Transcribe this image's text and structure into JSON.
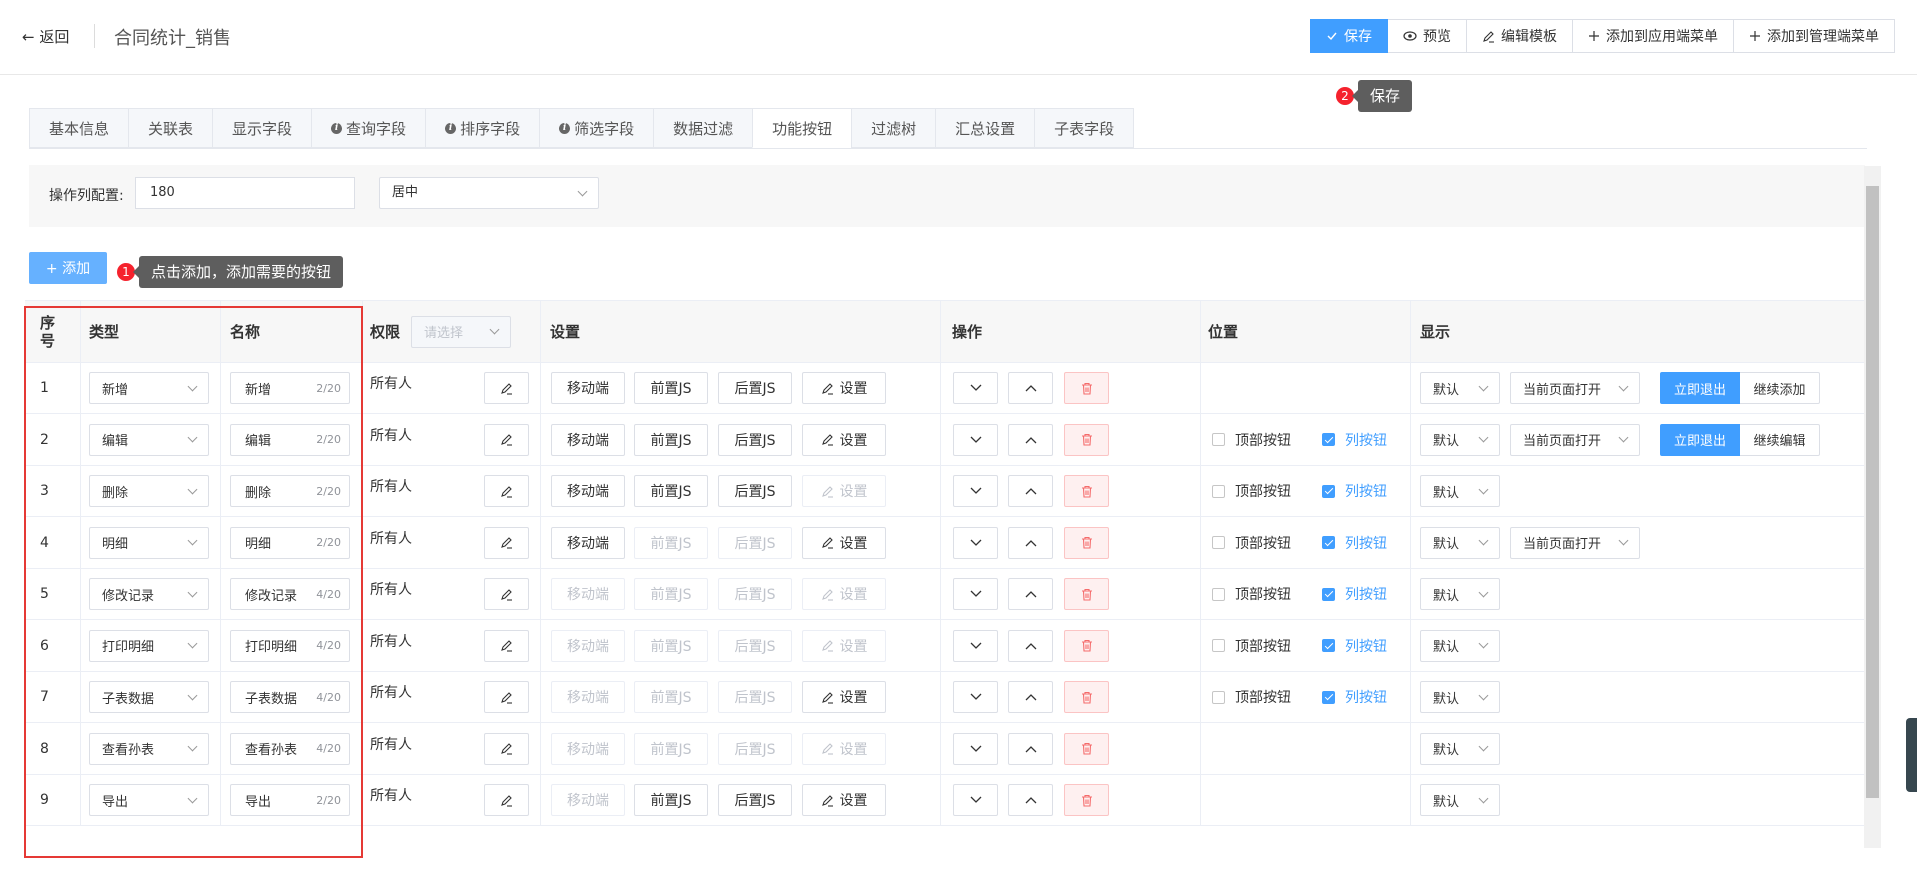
{
  "header": {
    "back_label": "返回",
    "title": "合同统计_销售",
    "toolbar": [
      {
        "label": "保存",
        "icon": "check-icon",
        "primary": true
      },
      {
        "label": "预览",
        "icon": "eye-icon"
      },
      {
        "label": "编辑模板",
        "icon": "edit-icon"
      },
      {
        "label": "添加到应用端菜单",
        "icon": "plus-icon"
      },
      {
        "label": "添加到管理端菜单",
        "icon": "plus-icon"
      }
    ]
  },
  "tooltips": {
    "save_badge": "2",
    "save_text": "保存",
    "add_badge": "1",
    "add_text": "点击添加，添加需要的按钮"
  },
  "tabs": [
    {
      "label": "基本信息"
    },
    {
      "label": "关联表"
    },
    {
      "label": "显示字段"
    },
    {
      "label": "查询字段",
      "info": true
    },
    {
      "label": "排序字段",
      "info": true
    },
    {
      "label": "筛选字段",
      "info": true
    },
    {
      "label": "数据过滤"
    },
    {
      "label": "功能按钮",
      "active": true
    },
    {
      "label": "过滤树"
    },
    {
      "label": "汇总设置"
    },
    {
      "label": "子表字段"
    }
  ],
  "config": {
    "label": "操作列配置:",
    "width_value": "180",
    "align_value": "居中"
  },
  "add_button": "+ 添加",
  "columns": {
    "index": "序号",
    "type": "类型",
    "name": "名称",
    "permission": "权限",
    "permission_placeholder": "请选择",
    "settings": "设置",
    "operation": "操作",
    "position": "位置",
    "display": "显示"
  },
  "labels": {
    "mobile": "移动端",
    "pre_js": "前置JS",
    "post_js": "后置JS",
    "setup": "设置",
    "top_button": "顶部按钮",
    "column_button": "列按钮"
  },
  "rows": [
    {
      "index": "1",
      "type": "新增",
      "name": "新增",
      "count": "2/20",
      "permission": "所有人",
      "mobile": true,
      "pre": true,
      "post": true,
      "setup": true,
      "position": false,
      "top": false,
      "col": false,
      "display": "默认",
      "open": "当前页面打开",
      "exit": "立即退出",
      "cont": "继续添加"
    },
    {
      "index": "2",
      "type": "编辑",
      "name": "编辑",
      "count": "2/20",
      "permission": "所有人",
      "mobile": true,
      "pre": true,
      "post": true,
      "setup": true,
      "position": true,
      "top": false,
      "col": true,
      "display": "默认",
      "open": "当前页面打开",
      "exit": "立即退出",
      "cont": "继续编辑"
    },
    {
      "index": "3",
      "type": "删除",
      "name": "删除",
      "count": "2/20",
      "permission": "所有人",
      "mobile": true,
      "pre": true,
      "post": true,
      "setup": false,
      "position": true,
      "top": false,
      "col": true,
      "display": "默认",
      "open": "",
      "exit": "",
      "cont": ""
    },
    {
      "index": "4",
      "type": "明细",
      "name": "明细",
      "count": "2/20",
      "permission": "所有人",
      "mobile": true,
      "pre": false,
      "post": false,
      "setup": true,
      "position": true,
      "top": false,
      "col": true,
      "display": "默认",
      "open": "当前页面打开",
      "exit": "",
      "cont": ""
    },
    {
      "index": "5",
      "type": "修改记录",
      "name": "修改记录",
      "count": "4/20",
      "permission": "所有人",
      "mobile": false,
      "pre": false,
      "post": false,
      "setup": false,
      "position": true,
      "top": false,
      "col": true,
      "display": "默认",
      "open": "",
      "exit": "",
      "cont": ""
    },
    {
      "index": "6",
      "type": "打印明细",
      "name": "打印明细",
      "count": "4/20",
      "permission": "所有人",
      "mobile": false,
      "pre": false,
      "post": false,
      "setup": false,
      "position": true,
      "top": false,
      "col": true,
      "display": "默认",
      "open": "",
      "exit": "",
      "cont": ""
    },
    {
      "index": "7",
      "type": "子表数据",
      "name": "子表数据",
      "count": "4/20",
      "permission": "所有人",
      "mobile": false,
      "pre": false,
      "post": false,
      "setup": true,
      "position": true,
      "top": false,
      "col": true,
      "display": "默认",
      "open": "",
      "exit": "",
      "cont": ""
    },
    {
      "index": "8",
      "type": "查看孙表",
      "name": "查看孙表",
      "count": "4/20",
      "permission": "所有人",
      "mobile": false,
      "pre": false,
      "post": false,
      "setup": false,
      "position": false,
      "top": false,
      "col": false,
      "display": "默认",
      "open": "",
      "exit": "",
      "cont": ""
    },
    {
      "index": "9",
      "type": "导出",
      "name": "导出",
      "count": "2/20",
      "permission": "所有人",
      "mobile": false,
      "pre": true,
      "post": true,
      "setup": true,
      "position": false,
      "top": false,
      "col": false,
      "display": "默认",
      "open": "",
      "exit": "",
      "cont": ""
    }
  ],
  "colors": {
    "primary": "#409eff",
    "danger": "#f56c6c",
    "highlight": "#e53935"
  }
}
